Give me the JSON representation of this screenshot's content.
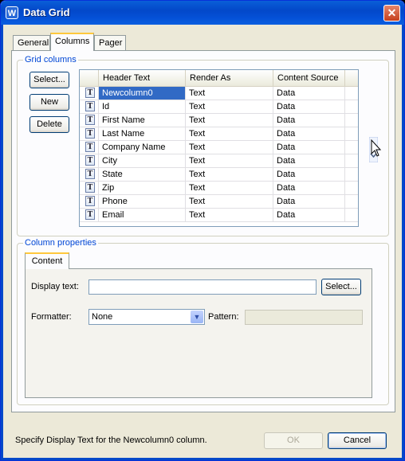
{
  "window": {
    "title": "Data Grid",
    "app_icon": "W"
  },
  "tabs": [
    {
      "label": "General"
    },
    {
      "label": "Columns"
    },
    {
      "label": "Pager"
    }
  ],
  "grid_columns": {
    "group_label": "Grid columns",
    "buttons": {
      "select": "Select...",
      "new": "New",
      "delete": "Delete"
    },
    "headers": [
      "Header Text",
      "Render As",
      "Content Source"
    ],
    "rows": [
      {
        "icon": "T",
        "header_text": "Newcolumn0",
        "render_as": "Text",
        "content_source": "Data"
      },
      {
        "icon": "T",
        "header_text": "Id",
        "render_as": "Text",
        "content_source": "Data"
      },
      {
        "icon": "T",
        "header_text": "First Name",
        "render_as": "Text",
        "content_source": "Data"
      },
      {
        "icon": "T",
        "header_text": "Last Name",
        "render_as": "Text",
        "content_source": "Data"
      },
      {
        "icon": "T",
        "header_text": "Company Name",
        "render_as": "Text",
        "content_source": "Data"
      },
      {
        "icon": "T",
        "header_text": "City",
        "render_as": "Text",
        "content_source": "Data"
      },
      {
        "icon": "T",
        "header_text": "State",
        "render_as": "Text",
        "content_source": "Data"
      },
      {
        "icon": "T",
        "header_text": "Zip",
        "render_as": "Text",
        "content_source": "Data"
      },
      {
        "icon": "T",
        "header_text": "Phone",
        "render_as": "Text",
        "content_source": "Data"
      },
      {
        "icon": "T",
        "header_text": "Email",
        "render_as": "Text",
        "content_source": "Data"
      }
    ]
  },
  "column_properties": {
    "group_label": "Column properties",
    "tab_label": "Content",
    "display_text_label": "Display text:",
    "display_text_value": "",
    "select_button": "Select...",
    "formatter_label": "Formatter:",
    "formatter_value": "None",
    "pattern_label": "Pattern:",
    "pattern_value": ""
  },
  "footer": {
    "status": "Specify Display Text for the Newcolumn0 column.",
    "ok": "OK",
    "cancel": "Cancel"
  },
  "colors": {
    "title_bar": "#0450d6",
    "accent_tab": "#ffc83c",
    "selection": "#316ac5",
    "group_label": "#0046d5"
  }
}
